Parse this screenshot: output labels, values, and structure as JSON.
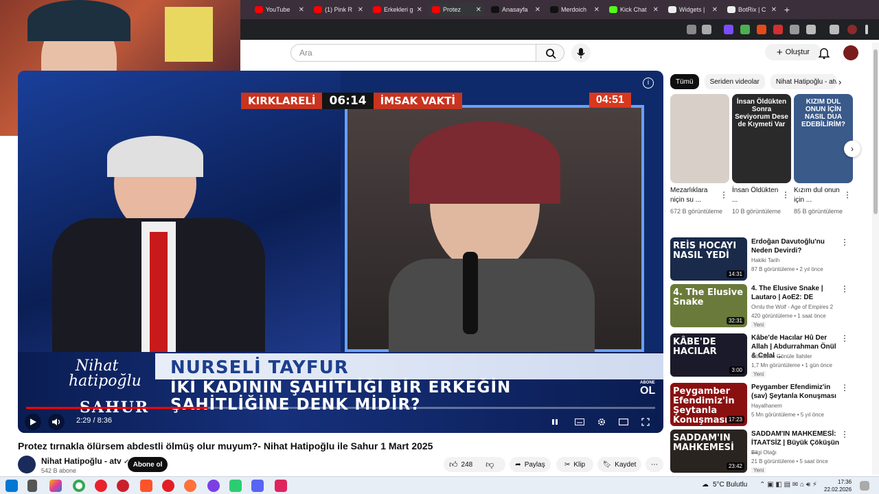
{
  "browser": {
    "tabs": [
      {
        "label": "YouTube",
        "color": "#ff0000"
      },
      {
        "label": "(1) Pink R",
        "color": "#ff0000"
      },
      {
        "label": "Erkekleri g",
        "color": "#ff0000"
      },
      {
        "label": "Protez",
        "color": "#ff0000"
      },
      {
        "label": "Anasayfa",
        "color": "#111111"
      },
      {
        "label": "Merdoich",
        "color": "#111111"
      },
      {
        "label": "Kick Chat",
        "color": "#53fc18"
      },
      {
        "label": "Widgets |",
        "color": "#eeeeee"
      },
      {
        "label": "BotRix | C",
        "color": "#eeeeee"
      }
    ],
    "new_tab": "+"
  },
  "youtube": {
    "search_placeholder": "Ara",
    "create_label": "Oluştur",
    "player": {
      "city": "KIRKLARELİ",
      "clock": "06:14",
      "imsak_label": "İMSAK VAKTİ",
      "countdown": "04:51",
      "guest_name": "NURSELİ TAYFUR",
      "question_line1": "İKİ KADININ ŞAHİTLİĞİ BİR ERKEĞİN",
      "question_line2": "ŞAHİTLİĞİNE DENK MİDİR?",
      "show_logo_line1": "Nihat",
      "show_logo_line2": "hatipoğlu",
      "show_logo_line3": "SAHUR",
      "ol_logo_top": "ABONE",
      "ol_logo": "OL",
      "time_text": "2:29 / 8:36",
      "progress": 0.289
    },
    "video_title": "Protez tırnakla ölürsem abdestli ölmüş olur muyum?- Nihat Hatipoğlu ile Sahur 1 Mart 2025",
    "channel": {
      "name": "Nihat Hatipoğlu - atv",
      "subs": "542 B abone",
      "subscribe": "Abone ol"
    },
    "actions": {
      "likes": "248",
      "share": "Paylaş",
      "clip": "Klip",
      "save": "Kaydet"
    },
    "chips": [
      "Tümü",
      "Seriden videolar",
      "Nihat Hatipoğlu - atv"
    ],
    "shorts": [
      {
        "title": "Mezarlıklara niçin su ...",
        "views": "672 B görüntüleme",
        "thumb_text": "",
        "color": "#d8d0c8"
      },
      {
        "title": "İnsan Öldükten ...",
        "views": "10 B görüntüleme",
        "thumb_text": "İnsan Öldükten Sonra Seviyorum Dese de Kıymeti Var",
        "color": "#2a2a2a"
      },
      {
        "title": "Kızım dul onun için ...",
        "views": "85 B görüntüleme",
        "thumb_text": "KIZIM DUL ONUN İÇİN NASIL DUA EDEBİLİRİM?",
        "color": "#3a5a8a"
      }
    ],
    "videos": [
      {
        "title": "Erdoğan Davutoğlu'nu Neden Devirdi?",
        "channel": "Hakiki Tarih",
        "meta": "87 B görüntüleme • 2 yıl önce",
        "new": "",
        "duration": "14:31",
        "label": "REİS HOCAYI NASIL YEDİ",
        "color": "#1a2a4a"
      },
      {
        "title": "4. The Elusive Snake | Lautaro | AoE2: DE",
        "channel": "Ornlu the Wolf - Age of Empires 2",
        "meta": "420 görüntüleme • 1 saat önce",
        "new": "Yeni",
        "duration": "32:31",
        "label": "4. The Elusive Snake",
        "color": "#6a7a3a"
      },
      {
        "title": "Kâbe'de Hacılar Hû Der Allah | Abdurrahman Önül & Celal ...",
        "channel": "Gönülden Gönüle İlahiler",
        "meta": "1,7 Mn görüntüleme • 1 gün önce",
        "new": "Yeni",
        "duration": "3:00",
        "label": "KÂBE'DE HACILAR",
        "color": "#1a1a2a"
      },
      {
        "title": "Peygamber Efendimiz'in (sav) Şeytanla Konuşması",
        "channel": "Hayalhanem",
        "meta": "5 Mn görüntüleme • 5 yıl önce",
        "new": "",
        "duration": "17:23",
        "label": "Peygamber Efendimiz'in Şeytanla Konuşması",
        "color": "#8a1010"
      },
      {
        "title": "SADDAM'IN MAHKEMESİ: İTAATSİZ | Büyük Çöküşün ...",
        "channel": "Bilgi Otağı",
        "meta": "21 B görüntüleme • 5 saat önce",
        "new": "Yeni",
        "duration": "23:42",
        "label": "SADDAM'IN MAHKEMESİ",
        "color": "#2a2420"
      }
    ]
  },
  "taskbar": {
    "weather": "5°C  Bulutlu",
    "time": "17:36",
    "date": "22.02.2026"
  }
}
